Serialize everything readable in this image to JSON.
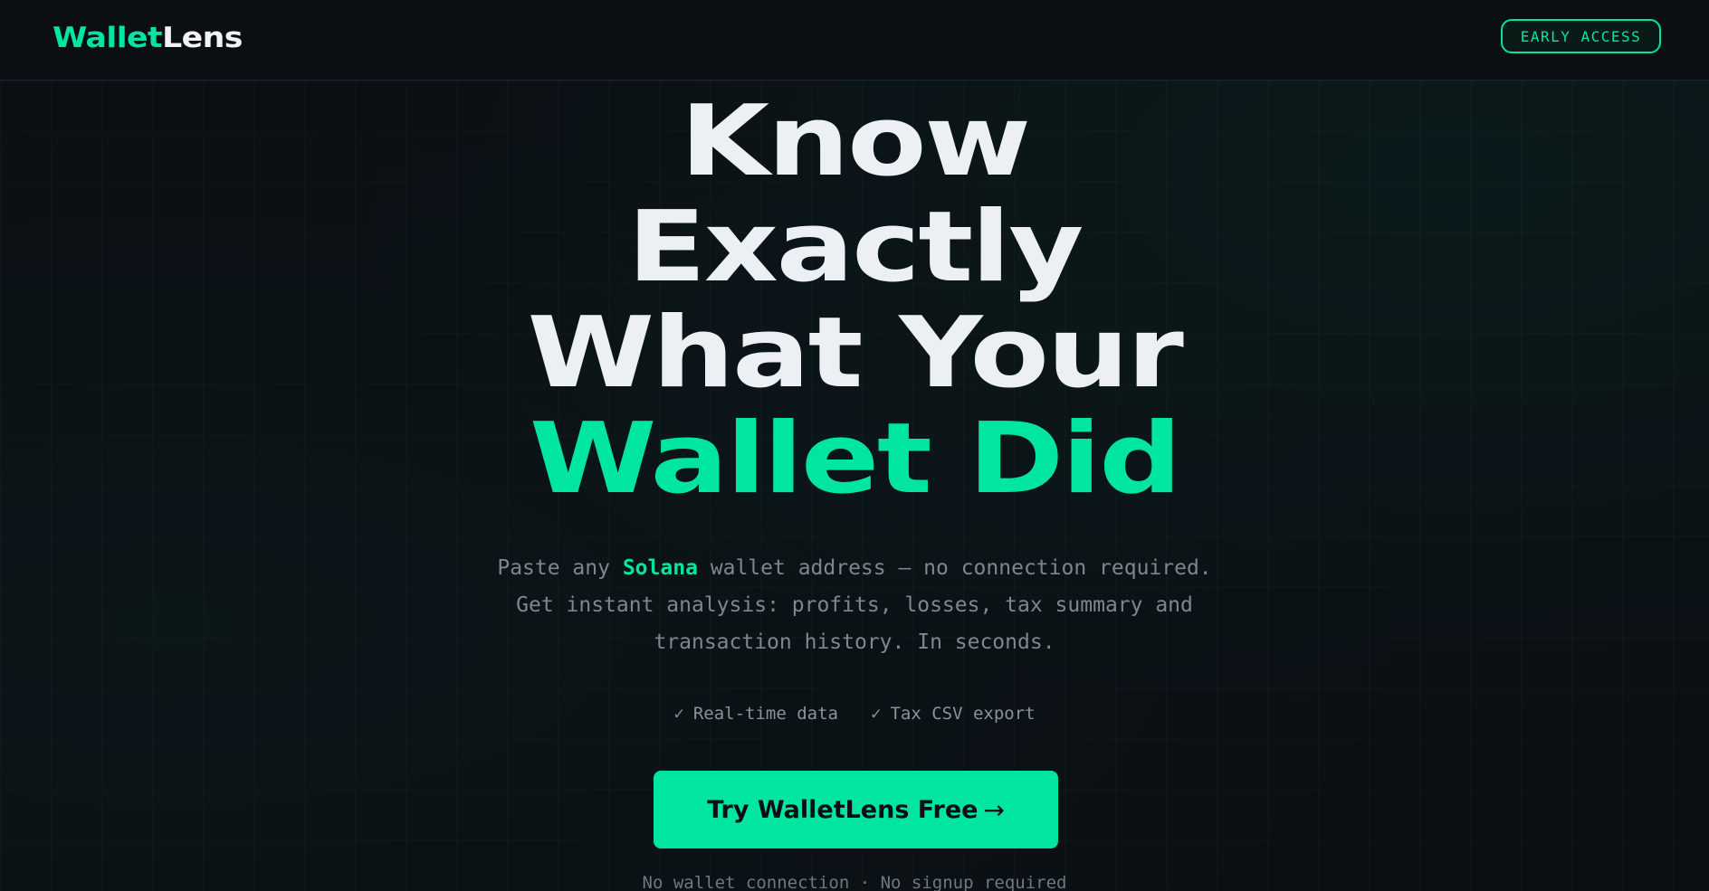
{
  "header": {
    "logo_part1": "Wallet",
    "logo_part2": "Lens",
    "early_access_label": "EARLY ACCESS"
  },
  "hero": {
    "title_line1": "Know",
    "title_line2": "Exactly",
    "title_line3": "What Your",
    "title_line4_accent": "Wallet Did",
    "subtitle_pre": "Paste any ",
    "subtitle_highlight": "Solana",
    "subtitle_post": " wallet address — no connection required. Get instant analysis: profits, losses, tax summary and transaction history. In seconds.",
    "features": [
      {
        "check": "✓",
        "label": "Real-time data"
      },
      {
        "check": "✓",
        "label": "Tax CSV export"
      }
    ],
    "cta_label": "Try WalletLens Free",
    "cta_arrow": "→",
    "footnote": "No wallet connection · No signup required"
  },
  "colors": {
    "accent": "#00e5a0",
    "background": "#0b0f14",
    "text": "#eceff3",
    "muted": "#7d8791"
  }
}
